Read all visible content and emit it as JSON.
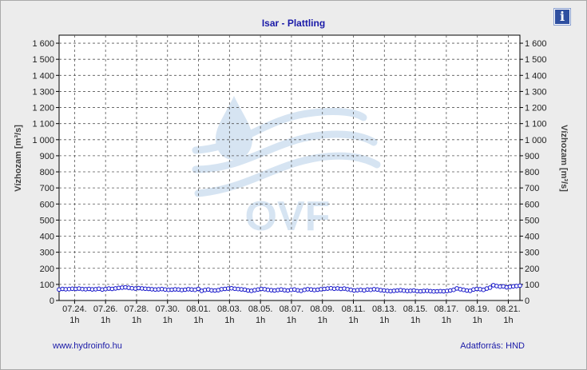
{
  "header": {
    "title": "Isar - Plattling",
    "info_icon": "info-icon",
    "info_glyph": "i"
  },
  "footer": {
    "website": "www.hydroinfo.hu",
    "source": "Adatforrás: HND"
  },
  "watermark": {
    "text": "OVF",
    "color": "#cfe0f0"
  },
  "chart_data": {
    "type": "line",
    "title": "Isar - Plattling",
    "ylabel_left": "Vízhozam [m³/s]",
    "ylabel_right": "Vízhozam [m³/s]",
    "ylim": [
      0,
      1650
    ],
    "yticks": [
      0,
      100,
      200,
      300,
      400,
      500,
      600,
      700,
      800,
      900,
      1000,
      1100,
      1200,
      1300,
      1400,
      1500,
      1600
    ],
    "ytick_labels": [
      "0",
      "100",
      "200",
      "300",
      "400",
      "500",
      "600",
      "700",
      "800",
      "900",
      "1 000",
      "1 100",
      "1 200",
      "1 300",
      "1 400",
      "1 500",
      "1 600"
    ],
    "xlim": [
      0,
      29.75
    ],
    "xticks": [
      1,
      3,
      5,
      7,
      9,
      11,
      13,
      15,
      17,
      19,
      21,
      23,
      25,
      27,
      29
    ],
    "xtick_labels": [
      "07.24.",
      "07.26.",
      "07.28.",
      "07.30.",
      "08.01.",
      "08.03.",
      "08.05.",
      "08.07.",
      "08.09.",
      "08.11.",
      "08.13.",
      "08.15.",
      "08.17.",
      "08.19.",
      "08.21."
    ],
    "xtick_sublabel": "1h",
    "grid": true,
    "line_color": "#1010c8",
    "marker": "circle",
    "series": [
      {
        "values": [
          68,
          72,
          70,
          71,
          73,
          72,
          74,
          71,
          70,
          72,
          69,
          70,
          73,
          68,
          71,
          74,
          72,
          75,
          78,
          80,
          82,
          79,
          76,
          74,
          77,
          75,
          73,
          72,
          70,
          68,
          69,
          71,
          68,
          66,
          67,
          69,
          68,
          65,
          67,
          70,
          68,
          66,
          72,
          60,
          65,
          68,
          63,
          62,
          64,
          70,
          72,
          74,
          76,
          73,
          71,
          69,
          67,
          62,
          60,
          64,
          68,
          72,
          70,
          66,
          64,
          62,
          65,
          68,
          64,
          62,
          66,
          68,
          63,
          60,
          66,
          70,
          68,
          65,
          67,
          70,
          72,
          74,
          76,
          73,
          75,
          72,
          74,
          70,
          66,
          62,
          64,
          66,
          63,
          68,
          66,
          70,
          68,
          64,
          62,
          60,
          58,
          60,
          62,
          64,
          61,
          59,
          60,
          62,
          58,
          57,
          59,
          60,
          58,
          56,
          57,
          58,
          57,
          59,
          62,
          66,
          75,
          70,
          66,
          62,
          60,
          68,
          72,
          70,
          66,
          74,
          80,
          95,
          90,
          86,
          88,
          82,
          85,
          88,
          90,
          92
        ]
      }
    ]
  }
}
